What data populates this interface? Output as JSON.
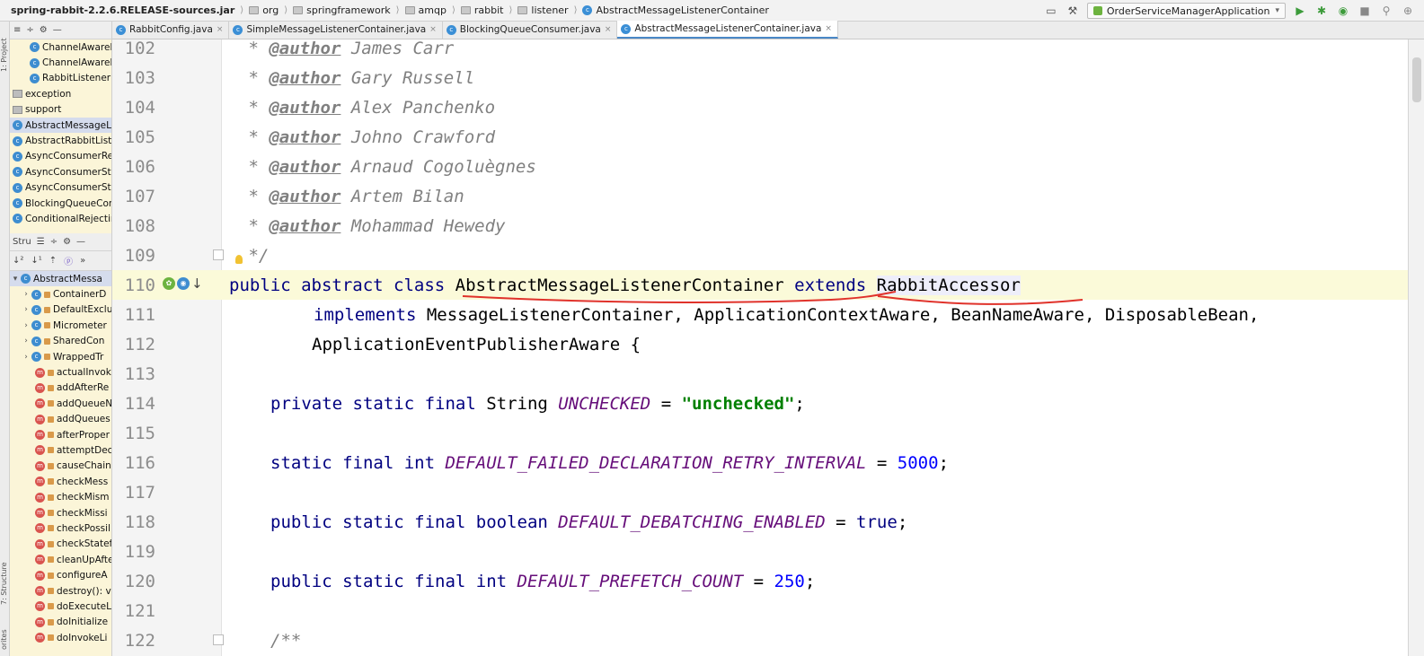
{
  "breadcrumb": [
    {
      "label": "spring-rabbit-2.2.6.RELEASE-sources.jar",
      "icon": "jar-icon"
    },
    {
      "label": "org",
      "icon": "folder-icon"
    },
    {
      "label": "springframework",
      "icon": "folder-icon"
    },
    {
      "label": "amqp",
      "icon": "folder-icon"
    },
    {
      "label": "rabbit",
      "icon": "folder-icon"
    },
    {
      "label": "listener",
      "icon": "folder-icon"
    },
    {
      "label": "AbstractMessageListenerContainer",
      "icon": "class-icon"
    }
  ],
  "run_config": {
    "label": "OrderServiceManagerApplication"
  },
  "left_strip": {
    "top_label": "1: Project",
    "bottom_label": "7: Structure",
    "favorites_label": "orites"
  },
  "project_tree": [
    {
      "label": "ChannelAwareBa",
      "icon": "class-icon",
      "indent": 1
    },
    {
      "label": "ChannelAwareM",
      "icon": "class-icon",
      "indent": 1
    },
    {
      "label": "RabbitListenerEr",
      "icon": "class-icon",
      "indent": 1
    },
    {
      "label": "exception",
      "icon": "package-icon",
      "indent": 0
    },
    {
      "label": "support",
      "icon": "package-icon",
      "indent": 0
    },
    {
      "label": "AbstractMessageLis",
      "icon": "class-icon",
      "indent": 0,
      "selected": true
    },
    {
      "label": "AbstractRabbitListen",
      "icon": "class-icon",
      "indent": 0
    },
    {
      "label": "AsyncConsumerRes",
      "icon": "class-icon",
      "indent": 0
    },
    {
      "label": "AsyncConsumerStar",
      "icon": "class-icon",
      "indent": 0
    },
    {
      "label": "AsyncConsumerStop",
      "icon": "class-icon",
      "indent": 0
    },
    {
      "label": "BlockingQueueCons",
      "icon": "class-icon",
      "indent": 0
    },
    {
      "label": "ConditionalRejecting",
      "icon": "class-icon",
      "indent": 0
    }
  ],
  "structure_panel": {
    "title": "Stru",
    "root": "AbstractMessa",
    "items": [
      {
        "label": "ContainerD",
        "icon": "class-icon",
        "expandable": true
      },
      {
        "label": "DefaultExclu",
        "icon": "class-icon",
        "expandable": true
      },
      {
        "label": "Micrometer",
        "icon": "class-icon",
        "expandable": true
      },
      {
        "label": "SharedCon",
        "icon": "class-icon",
        "expandable": true
      },
      {
        "label": "WrappedTr",
        "icon": "class-icon",
        "expandable": true
      },
      {
        "label": "actualInvok",
        "icon": "method-icon",
        "expandable": false
      },
      {
        "label": "addAfterRe",
        "icon": "method-icon",
        "expandable": false
      },
      {
        "label": "addQueueN",
        "icon": "method-icon",
        "expandable": false
      },
      {
        "label": "addQueues",
        "icon": "method-icon",
        "expandable": false
      },
      {
        "label": "afterProper",
        "icon": "method-icon",
        "expandable": false
      },
      {
        "label": "attemptDec",
        "icon": "method-icon",
        "expandable": false
      },
      {
        "label": "causeChain",
        "icon": "method-icon",
        "expandable": false
      },
      {
        "label": "checkMess",
        "icon": "method-icon",
        "expandable": false
      },
      {
        "label": "checkMism",
        "icon": "method-icon",
        "expandable": false
      },
      {
        "label": "checkMissi",
        "icon": "method-icon",
        "expandable": false
      },
      {
        "label": "checkPossil",
        "icon": "method-icon",
        "expandable": false
      },
      {
        "label": "checkStatef",
        "icon": "method-icon",
        "expandable": false
      },
      {
        "label": "cleanUpAfte",
        "icon": "method-icon",
        "expandable": false
      },
      {
        "label": "configureA",
        "icon": "method-icon",
        "expandable": false
      },
      {
        "label": "destroy(): v",
        "icon": "method-icon",
        "expandable": false
      },
      {
        "label": "doExecuteL",
        "icon": "method-icon",
        "expandable": false
      },
      {
        "label": "doInitialize",
        "icon": "method-icon",
        "expandable": false
      },
      {
        "label": "doInvokeLi",
        "icon": "method-icon",
        "expandable": false
      }
    ]
  },
  "tabs": [
    {
      "label": "RabbitConfig.java",
      "active": false
    },
    {
      "label": "SimpleMessageListenerContainer.java",
      "active": false
    },
    {
      "label": "BlockingQueueConsumer.java",
      "active": false
    },
    {
      "label": "AbstractMessageListenerContainer.java",
      "active": true
    }
  ],
  "editor": {
    "lines": [
      {
        "n": "102",
        "author": "James Carr"
      },
      {
        "n": "103",
        "author": "Gary Russell"
      },
      {
        "n": "104",
        "author": "Alex Panchenko"
      },
      {
        "n": "105",
        "author": "Johno Crawford"
      },
      {
        "n": "106",
        "author": "Arnaud Cogoluègnes"
      },
      {
        "n": "107",
        "author": "Artem Bilan"
      },
      {
        "n": "108",
        "author": "Mohammad Hewedy"
      }
    ],
    "line_109": {
      "n": "109",
      "text": " */"
    },
    "line_110": {
      "n": "110",
      "kw1": "public abstract class ",
      "cls": "AbstractMessageListenerContainer",
      "kw2": " extends ",
      "sup": "RabbitAccessor"
    },
    "line_111": {
      "n": "111",
      "kw": "implements ",
      "rest": "MessageListenerContainer, ApplicationContextAware, BeanNameAware, DisposableBean,"
    },
    "line_112": {
      "n": "112",
      "rest": "ApplicationEventPublisherAware {"
    },
    "line_113": {
      "n": "113"
    },
    "line_114": {
      "n": "114",
      "kw": "private static final ",
      "type": "String ",
      "name": "UNCHECKED",
      "eq": " = ",
      "val": "\"unchecked\"",
      "end": ";"
    },
    "line_115": {
      "n": "115"
    },
    "line_116": {
      "n": "116",
      "kw": "static final int ",
      "name": "DEFAULT_FAILED_DECLARATION_RETRY_INTERVAL",
      "eq": " = ",
      "val": "5000",
      "end": ";"
    },
    "line_117": {
      "n": "117"
    },
    "line_118": {
      "n": "118",
      "kw": "public static final boolean ",
      "name": "DEFAULT_DEBATCHING_ENABLED",
      "eq": " = ",
      "val": "true",
      "end": ";"
    },
    "line_119": {
      "n": "119"
    },
    "line_120": {
      "n": "120",
      "kw": "public static final int ",
      "name": "DEFAULT_PREFETCH_COUNT",
      "eq": " = ",
      "val": "250",
      "end": ";"
    },
    "line_121": {
      "n": "121"
    },
    "line_122": {
      "n": "122",
      "text": "/**"
    },
    "doc_tag": "@author",
    "annotation_color": "#e0322a"
  }
}
